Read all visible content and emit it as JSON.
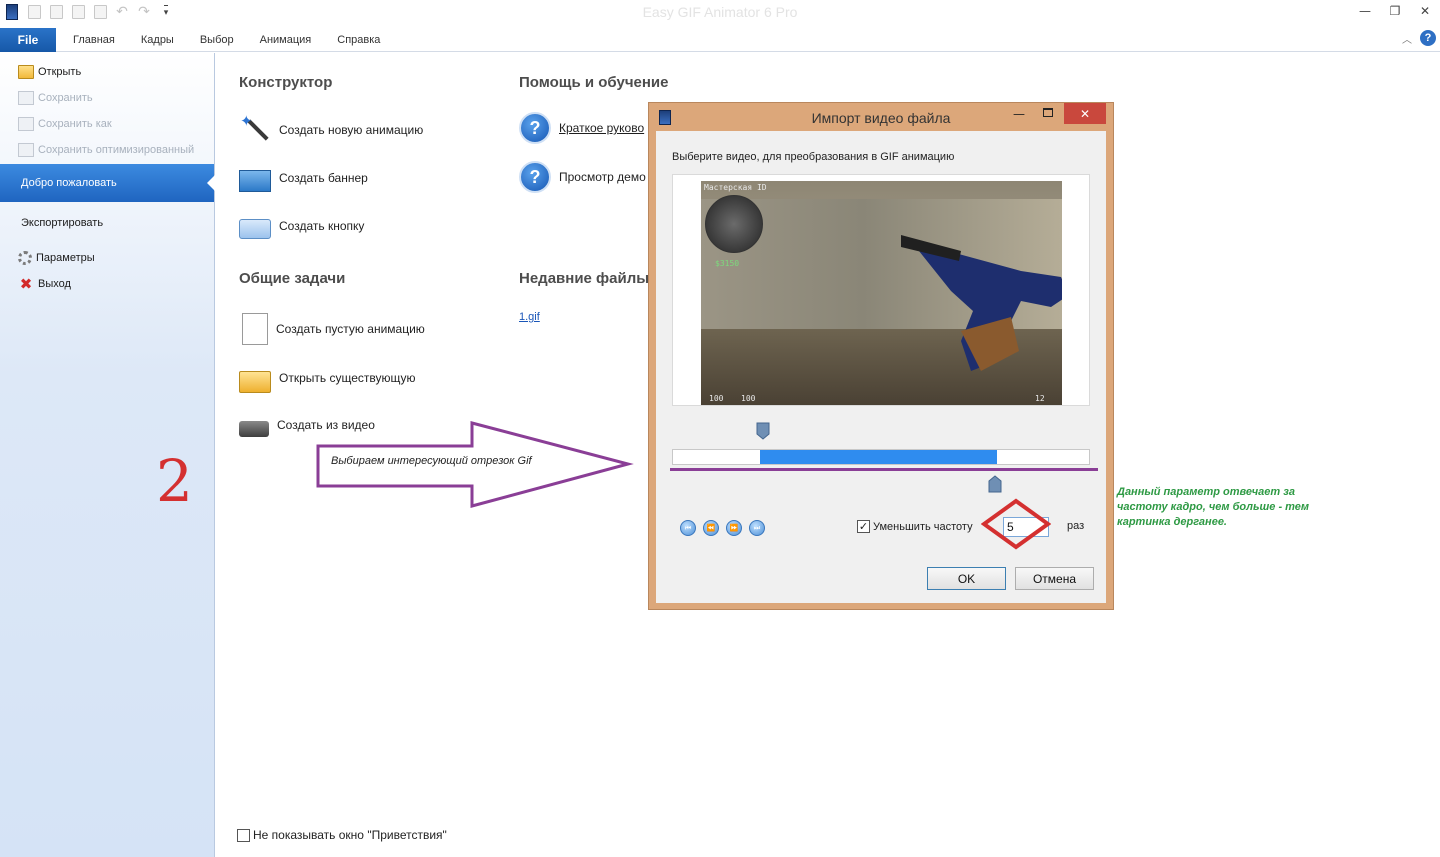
{
  "window": {
    "title": "Easy GIF Animator 6 Pro",
    "controls": {
      "minimize": "—",
      "restore": "❐",
      "close": "✕"
    }
  },
  "quick_access": [
    "app-icon",
    "new-icon",
    "open-icon",
    "save-icon",
    "save-all-icon",
    "undo-icon",
    "redo-icon",
    "customize-icon"
  ],
  "ribbon": {
    "file_tab": "File",
    "tabs": [
      "Главная",
      "Кадры",
      "Выбор",
      "Анимация",
      "Справка"
    ],
    "help": "?"
  },
  "backstage": {
    "open": "Открыть",
    "save": "Сохранить",
    "save_as": "Сохранить как",
    "save_optimized": "Сохранить оптимизированный",
    "welcome": "Добро пожаловать",
    "export": "Экспортировать",
    "settings": "Параметры",
    "exit": "Выход"
  },
  "annotation_number": "2",
  "constructor": {
    "title": "Конструктор",
    "new_animation": "Создать новую анимацию",
    "banner": "Создать баннер",
    "button": "Создать кнопку"
  },
  "common_tasks": {
    "title": "Общие задачи",
    "empty_animation": "Создать пустую анимацию",
    "open_existing": "Открыть существующую",
    "from_video": "Создать из видео"
  },
  "help_section": {
    "title": "Помощь и обучение",
    "quick_guide": "Краткое руково",
    "demo": "Просмотр демо"
  },
  "recent": {
    "title": "Недавние файлы",
    "files": [
      "1.gif"
    ]
  },
  "arrow_annotation": "Выбираем интересующий отрезок Gif",
  "dont_show_label": "Не показывать окно \"Приветствия\"",
  "dont_show_checked": false,
  "dialog": {
    "title": "Импорт видео файла",
    "minimize": "—",
    "close": "✕",
    "prompt": "Выберите видео, для преобразования в GIF анимацию",
    "hud": {
      "top_left": "Мастерская ID",
      "money": "$3150",
      "health": "100",
      "armor": "100",
      "ammo": "12"
    },
    "selection_start": 0.21,
    "selection_end": 0.78,
    "reduce_label": "Уменьшить частоту",
    "reduce_checked": true,
    "reduce_value": "5",
    "reduce_unit": "раз",
    "ok": "OK",
    "cancel": "Отмена",
    "controls": [
      "rewind-icon",
      "prev-frame-icon",
      "next-frame-icon",
      "end-icon"
    ]
  },
  "green_note": "Данный параметр отвечает за частоту кадро, чем больше - тем картинка дерганее.",
  "colors": {
    "accent_blue": "#2f8cef",
    "dialog_frame": "#dca77a",
    "annotation_purple": "#8a3e96",
    "annotation_red": "#d43030",
    "note_green": "#2e9a44"
  }
}
